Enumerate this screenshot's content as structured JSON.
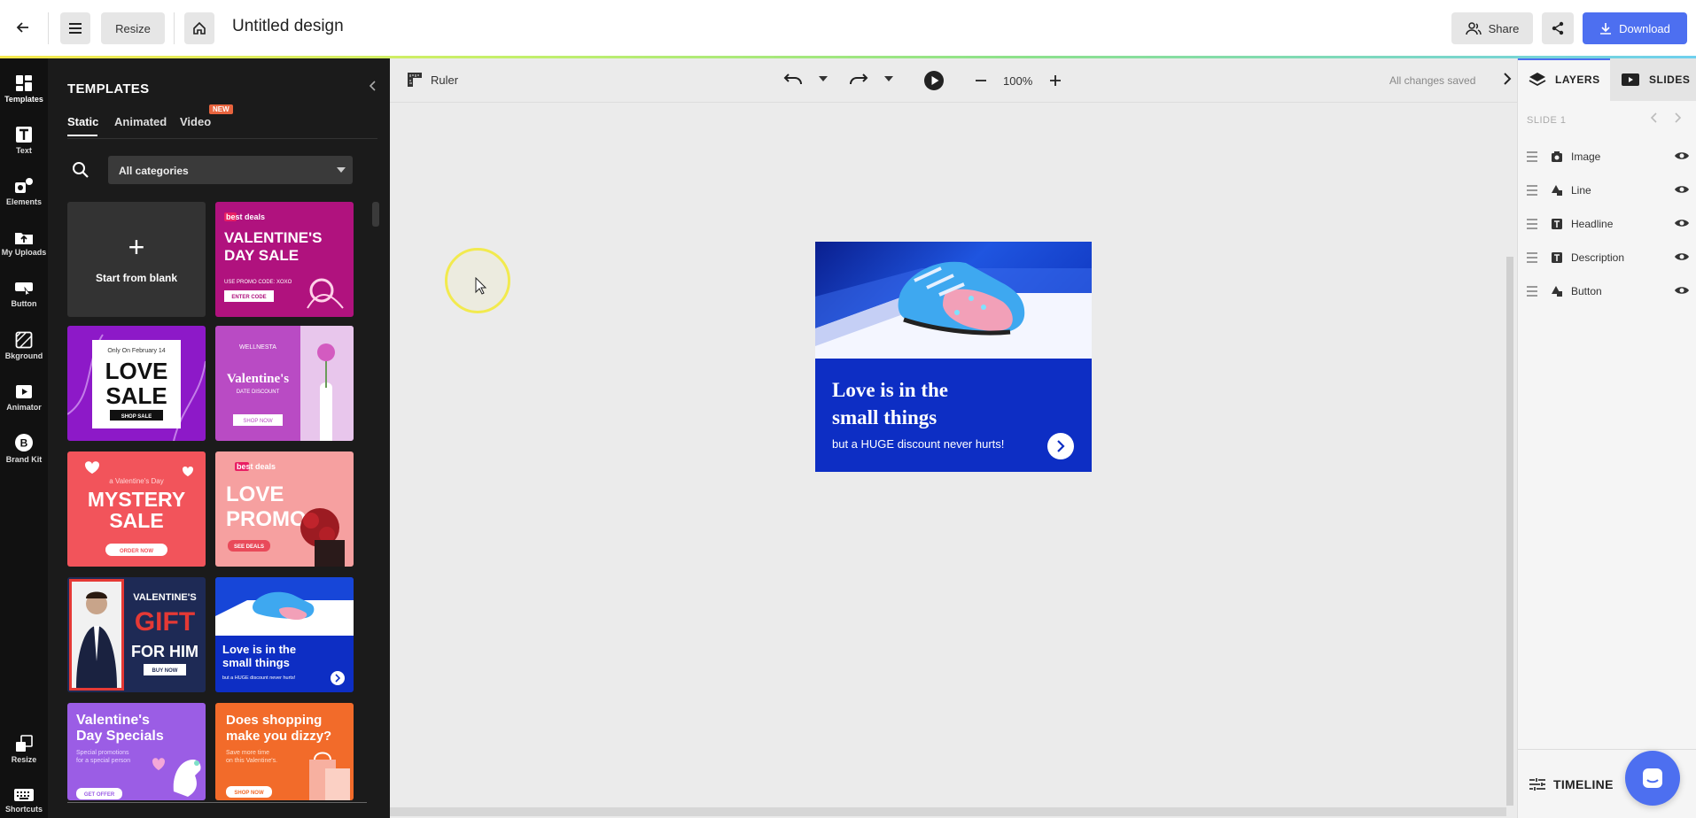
{
  "app": {
    "design_title": "Untitled design",
    "resize_label": "Resize",
    "share_label": "Share",
    "download_label": "Download",
    "accent_color": "#4d6ff0"
  },
  "rail": {
    "items": [
      {
        "label": "Templates",
        "icon": "templates-icon"
      },
      {
        "label": "Text",
        "icon": "text-icon"
      },
      {
        "label": "Elements",
        "icon": "elements-icon"
      },
      {
        "label": "My Uploads",
        "icon": "uploads-icon"
      },
      {
        "label": "Button",
        "icon": "button-icon"
      },
      {
        "label": "Bkground",
        "icon": "background-icon"
      },
      {
        "label": "Animator",
        "icon": "animator-icon"
      },
      {
        "label": "Brand Kit",
        "icon": "brand-kit-icon"
      },
      {
        "label": "Resize",
        "icon": "resize-icon"
      },
      {
        "label": "Shortcuts",
        "icon": "keyboard-icon"
      }
    ]
  },
  "panel": {
    "title": "TEMPLATES",
    "tabs": [
      {
        "label": "Static",
        "active": true
      },
      {
        "label": "Animated",
        "active": false
      },
      {
        "label": "Video",
        "active": false
      }
    ],
    "new_badge": "NEW",
    "category_select": "All categories",
    "blank_label": "Start from blank",
    "templates": [
      {
        "lines": [
          "best deals",
          "VALENTINE'S",
          "DAY SALE",
          "USE PROMO CODE: XOXO",
          "ENTER CODE"
        ],
        "bg": "#b0127e"
      },
      {
        "lines": [
          "Only On February 14",
          "LOVE",
          "SALE",
          "SHOP SALE"
        ],
        "bg": "#8d19c8"
      },
      {
        "lines": [
          "WELLNESTA",
          "Valentine's",
          "DATE DISCOUNT",
          "SHOP NOW"
        ],
        "bg": "#b94bc4"
      },
      {
        "lines": [
          "a Valentine's Day",
          "MYSTERY",
          "SALE",
          "ORDER NOW"
        ],
        "bg": "#f2545b"
      },
      {
        "lines": [
          "best deals",
          "LOVE",
          "PROMO",
          "SEE DEALS"
        ],
        "bg": "#f6a0a0"
      },
      {
        "lines": [
          "VALENTINE'S",
          "GIFT",
          "FOR HIM",
          "BUY NOW"
        ],
        "bg": "#1e2a55"
      },
      {
        "lines": [
          "Love is in the",
          "small things",
          "but a HUGE discount never hurts!"
        ],
        "bg": "#0d2ec4"
      },
      {
        "lines": [
          "Valentine's",
          "Day Specials",
          "Special promotions",
          "for a special person",
          "GET OFFER"
        ],
        "bg": "#9b5de5"
      },
      {
        "lines": [
          "Does shopping",
          "make you dizzy?",
          "Save more time",
          "on this Valentine's.",
          "SHOP NOW"
        ],
        "bg": "#f26b2a"
      }
    ]
  },
  "toolbar": {
    "ruler_label": "Ruler",
    "zoom": "100%",
    "save_status": "All changes saved"
  },
  "design": {
    "headline_line1": "Love is in the",
    "headline_line2": "small things",
    "description": "but a HUGE discount never hurts!",
    "bg_color": "#0d2ec4"
  },
  "right_panel": {
    "layers_tab": "LAYERS",
    "slides_tab": "SLIDES",
    "slide_label": "SLIDE 1",
    "layers": [
      {
        "name": "Image",
        "icon": "camera-icon"
      },
      {
        "name": "Line",
        "icon": "shapes-icon"
      },
      {
        "name": "Headline",
        "icon": "text-icon"
      },
      {
        "name": "Description",
        "icon": "text-icon"
      },
      {
        "name": "Button",
        "icon": "shapes-icon"
      }
    ],
    "timeline_label": "TIMELINE"
  }
}
